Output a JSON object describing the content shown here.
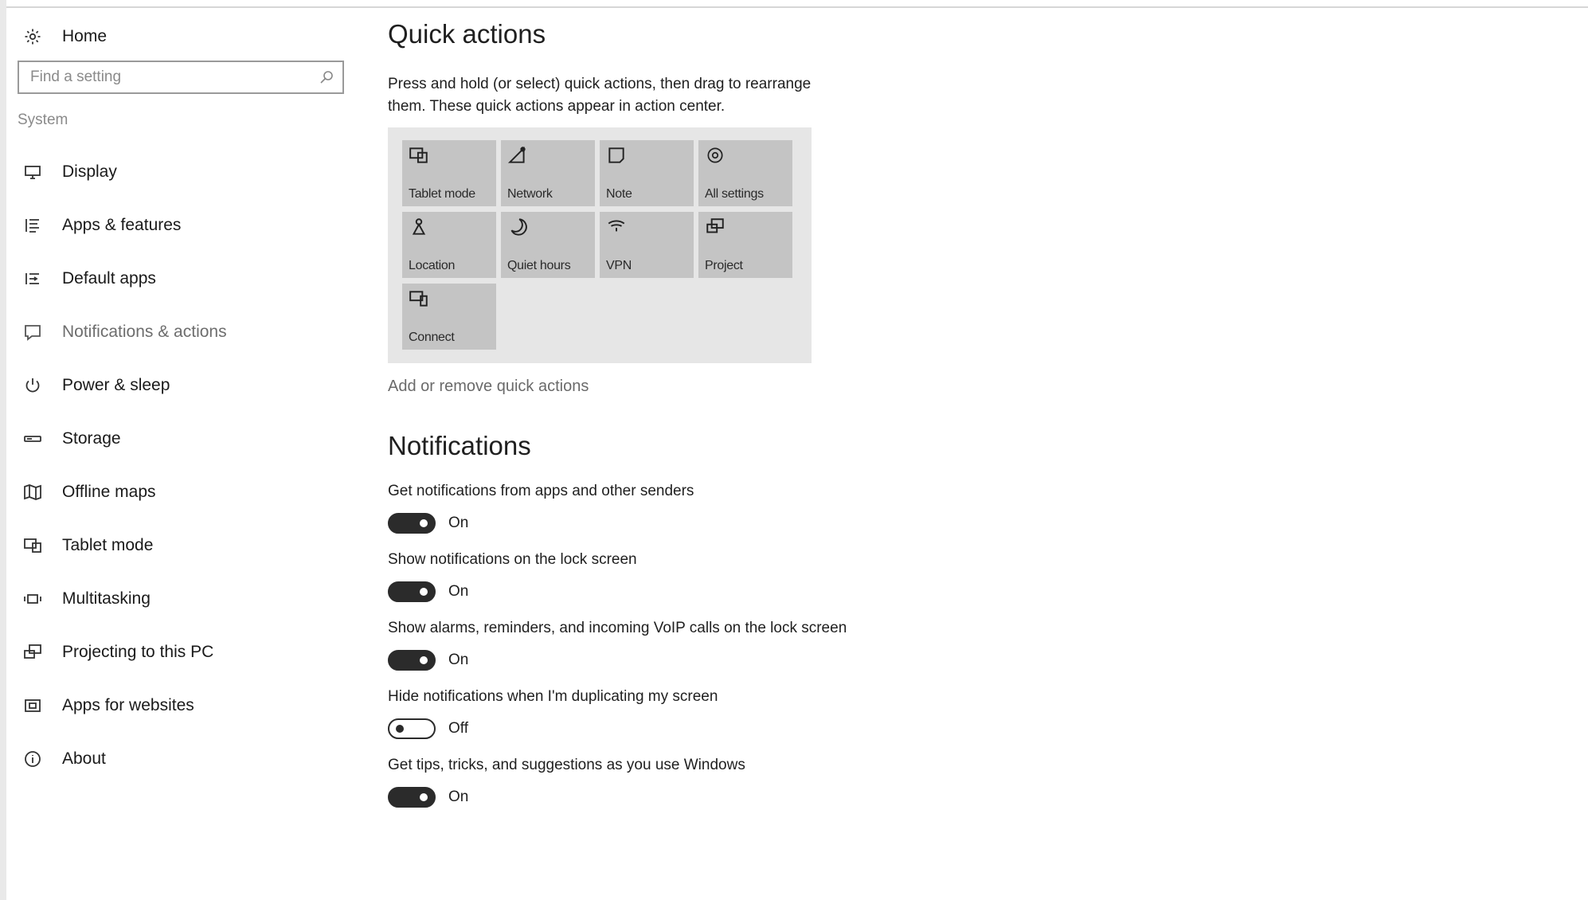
{
  "sidebar": {
    "home_label": "Home",
    "search_placeholder": "Find a setting",
    "section_label": "System",
    "items": [
      {
        "label": "Display",
        "icon": "display-icon"
      },
      {
        "label": "Apps & features",
        "icon": "apps-features-icon"
      },
      {
        "label": "Default apps",
        "icon": "default-apps-icon"
      },
      {
        "label": "Notifications & actions",
        "icon": "notifications-icon"
      },
      {
        "label": "Power & sleep",
        "icon": "power-icon"
      },
      {
        "label": "Storage",
        "icon": "storage-icon"
      },
      {
        "label": "Offline maps",
        "icon": "map-icon"
      },
      {
        "label": "Tablet mode",
        "icon": "tablet-mode-icon"
      },
      {
        "label": "Multitasking",
        "icon": "multitasking-icon"
      },
      {
        "label": "Projecting to this PC",
        "icon": "projecting-icon"
      },
      {
        "label": "Apps for websites",
        "icon": "apps-websites-icon"
      },
      {
        "label": "About",
        "icon": "info-icon"
      }
    ],
    "active_index": 3
  },
  "main": {
    "quick_actions_title": "Quick actions",
    "quick_actions_desc": "Press and hold (or select) quick actions, then drag to rearrange them. These quick actions appear in action center.",
    "tiles": [
      {
        "label": "Tablet mode",
        "icon": "tablet-mode-icon"
      },
      {
        "label": "Network",
        "icon": "network-icon"
      },
      {
        "label": "Note",
        "icon": "note-icon"
      },
      {
        "label": "All settings",
        "icon": "gear-icon"
      },
      {
        "label": "Location",
        "icon": "location-icon"
      },
      {
        "label": "Quiet hours",
        "icon": "moon-icon"
      },
      {
        "label": "VPN",
        "icon": "vpn-icon"
      },
      {
        "label": "Project",
        "icon": "project-icon"
      },
      {
        "label": "Connect",
        "icon": "connect-icon"
      }
    ],
    "add_remove_link": "Add or remove quick actions",
    "notifications_title": "Notifications",
    "settings": [
      {
        "label": "Get notifications from apps and other senders",
        "state": "On"
      },
      {
        "label": "Show notifications on the lock screen",
        "state": "On"
      },
      {
        "label": "Show alarms, reminders, and incoming VoIP calls on the lock screen",
        "state": "On"
      },
      {
        "label": "Hide notifications when I'm duplicating my screen",
        "state": "Off"
      },
      {
        "label": "Get tips, tricks, and suggestions as you use Windows",
        "state": "On"
      }
    ]
  }
}
